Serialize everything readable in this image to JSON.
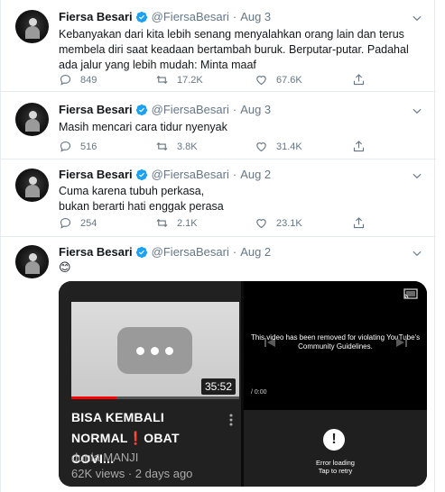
{
  "colors": {
    "accent": "#1da1f2",
    "muted": "#657786",
    "text": "#14171a",
    "youtube_red": "#ff0000"
  },
  "tweets": [
    {
      "author": "Fiersa Besari",
      "handle": "@FiersaBesari",
      "separator": "·",
      "date": "Aug 3",
      "text": "Kebanyakan dari kita lebih senang menyalahkan orang lain dan terus membela diri saat keadaan bertambah buruk. Berputar-putar. Padahal ada jalur yang lebih mudah: Minta maaf",
      "replies": "849",
      "retweets": "17.2K",
      "likes": "67.6K"
    },
    {
      "author": "Fiersa Besari",
      "handle": "@FiersaBesari",
      "separator": "·",
      "date": "Aug 3",
      "text": "Masih mencari cara tidur nyenyak",
      "replies": "516",
      "retweets": "3.8K",
      "likes": "31.4K"
    },
    {
      "author": "Fiersa Besari",
      "handle": "@FiersaBesari",
      "separator": "·",
      "date": "Aug 2",
      "text_line1": "Cuma karena tubuh perkasa,",
      "text_line2": "bukan berarti hati enggak perasa",
      "replies": "254",
      "retweets": "2.1K",
      "likes": "23.1K"
    },
    {
      "author": "Fiersa Besari",
      "handle": "@FiersaBesari",
      "separator": "·",
      "date": "Aug 2",
      "emoji": "😊"
    }
  ],
  "media": {
    "video_duration": "35:52",
    "watch_progress": 0.27,
    "title_line1": "BISA KEMBALI",
    "title_line2_prefix": "NORMAL",
    "title_excl": "❗",
    "title_line2_suffix": "OBAT COVI...",
    "channel": "dunia MANJI",
    "meta": "62K views · 2 days ago",
    "removed_message": "This video has been removed for violating YouTube's Community Guidelines.",
    "time_readout": "/ 0:00",
    "error_icon": "!",
    "error_line1": "Error loading",
    "error_line2": "Tap to retry"
  }
}
